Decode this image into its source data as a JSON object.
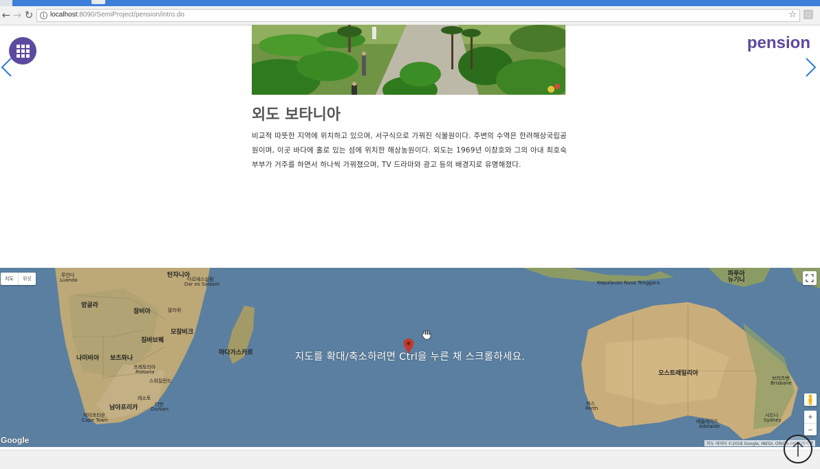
{
  "browser": {
    "url_host": "localhost",
    "url_path": ":8090/SemiProject/pension/intro.do"
  },
  "site": {
    "brand": "pension"
  },
  "attraction": {
    "title": "외도 보타니아",
    "description": "비교적 따뜻한 지역에 위치하고 있으며, 서구식으로 가꿔진 식물원이다. 주변의 수역은 한려해상국립공원이며, 이곳 바다에 홀로 있는 섬에 위치한 해상농원이다. 외도는 1969년 이창호와 그의 아내 최호숙 부부가 거주를 하면서 하나씩 가꿔졌으며, TV 드라마와 광고 등의 배경지로 유명해졌다."
  },
  "map": {
    "type_map": "지도",
    "type_satellite": "위성",
    "hint": "지도를 확대/축소하려면 Ctrl을 누른 채 스크롤하세요.",
    "zoom_in": "+",
    "zoom_out": "−",
    "logo": "Google",
    "attribution": "지도 데이터 ©2018 Google, INEGI, ORION-ME  이용약관",
    "labels": [
      {
        "text": "탄자니아",
        "cls": "big"
      },
      {
        "text": "다르에스살람",
        "cls": ""
      },
      {
        "text": "Dar es Salaam",
        "cls": ""
      },
      {
        "text": "앙골라",
        "cls": "big"
      },
      {
        "text": "잠비아",
        "cls": "big"
      },
      {
        "text": "말라위",
        "cls": ""
      },
      {
        "text": "모잠비크",
        "cls": "big"
      },
      {
        "text": "짐바브웨",
        "cls": "big"
      },
      {
        "text": "나미비아",
        "cls": "big"
      },
      {
        "text": "보츠와나",
        "cls": "big"
      },
      {
        "text": "프레토리아",
        "cls": ""
      },
      {
        "text": "Pretoria",
        "cls": ""
      },
      {
        "text": "스와질란드",
        "cls": ""
      },
      {
        "text": "레소토",
        "cls": ""
      },
      {
        "text": "더반",
        "cls": ""
      },
      {
        "text": "Durban",
        "cls": ""
      },
      {
        "text": "남아프리카",
        "cls": "big"
      },
      {
        "text": "케이프타운",
        "cls": ""
      },
      {
        "text": "Cape Town",
        "cls": ""
      },
      {
        "text": "마다가스카르",
        "cls": "big"
      },
      {
        "text": "루안다",
        "cls": ""
      },
      {
        "text": "Luanda",
        "cls": ""
      },
      {
        "text": "오스트레일리아",
        "cls": "big"
      },
      {
        "text": "퍼스",
        "cls": ""
      },
      {
        "text": "Perth",
        "cls": ""
      },
      {
        "text": "애들레이드",
        "cls": ""
      },
      {
        "text": "Adelaide",
        "cls": ""
      },
      {
        "text": "시드니",
        "cls": ""
      },
      {
        "text": "Sydney",
        "cls": ""
      },
      {
        "text": "브리즈번",
        "cls": ""
      },
      {
        "text": "Brisbane",
        "cls": ""
      },
      {
        "text": "파푸아",
        "cls": "big"
      },
      {
        "text": "뉴기니",
        "cls": "big"
      },
      {
        "text": "Kepulauan Nusa Tenggara",
        "cls": ""
      }
    ]
  },
  "colors": {
    "brand": "#5b4a9f",
    "arrow": "#2b7bd6",
    "ocean": "#5a7fa0"
  }
}
